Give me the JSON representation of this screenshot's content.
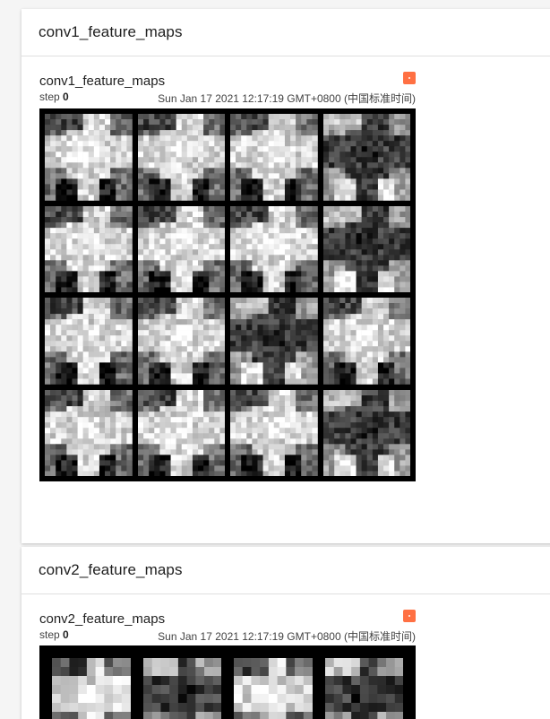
{
  "sections": [
    {
      "title": "conv1_feature_maps",
      "card": {
        "title": "conv1_feature_maps",
        "step_label": "step",
        "step_value": "0",
        "timestamp": "Sun Jan 17 2021 12:17:19 GMT+0800 (中国标准时间)",
        "menu_icon": "more-options-icon",
        "grid_rows": 4,
        "grid_cols": 4
      }
    },
    {
      "title": "conv2_feature_maps",
      "card": {
        "title": "conv2_feature_maps",
        "step_label": "step",
        "step_value": "0",
        "timestamp": "Sun Jan 17 2021 12:17:19 GMT+0800 (中国标准时间)",
        "menu_icon": "more-options-icon",
        "grid_rows": 1,
        "grid_cols": 4
      }
    }
  ],
  "colors": {
    "menu_accent": "#ff7043",
    "grid_border": "#000000"
  }
}
